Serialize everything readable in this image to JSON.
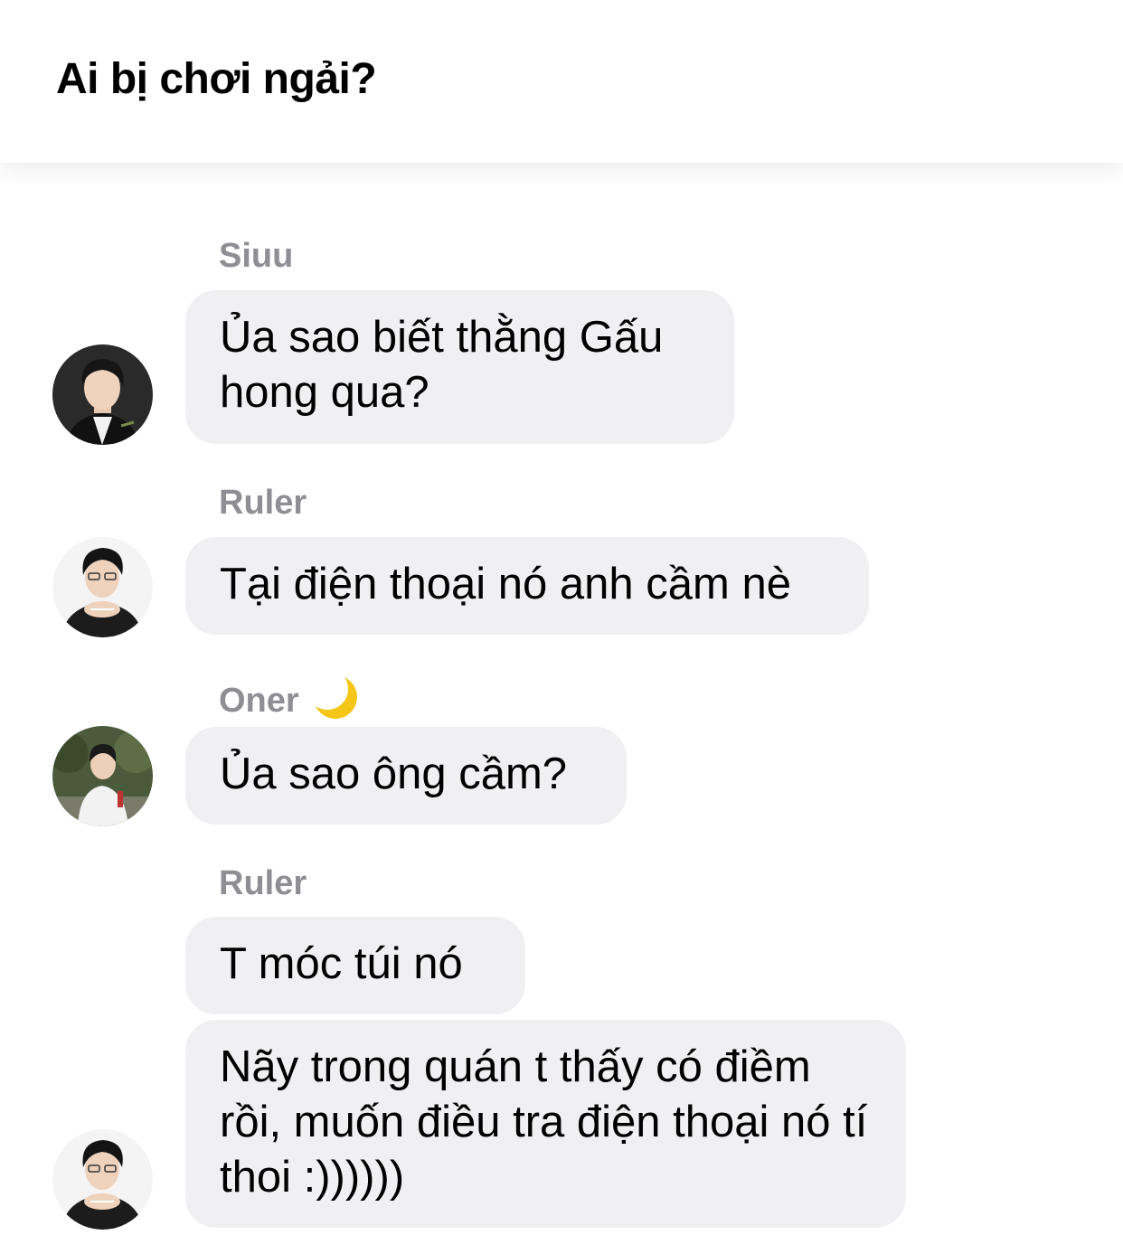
{
  "header": {
    "title": "Ai bị chơi ngải?"
  },
  "messages": [
    {
      "sender": "Siuu",
      "text": "Ủa sao biết thằng Gấu hong qua?"
    },
    {
      "sender": "Ruler",
      "text": "Tại điện thoại nó anh cầm nè"
    },
    {
      "sender": "Oner",
      "sender_icon": "crescent-moon-icon",
      "text": "Ủa sao ông cầm?"
    },
    {
      "sender": "Ruler",
      "text": "T móc túi nó"
    },
    {
      "text": "Nãy trong quán t thấy có điềm rồi, muốn điều tra điện thoại nó tí thoi :))))))"
    }
  ],
  "colors": {
    "bubble": "#f0f0f2",
    "sender_name": "#8e8e93",
    "moon": "#f5c518"
  }
}
